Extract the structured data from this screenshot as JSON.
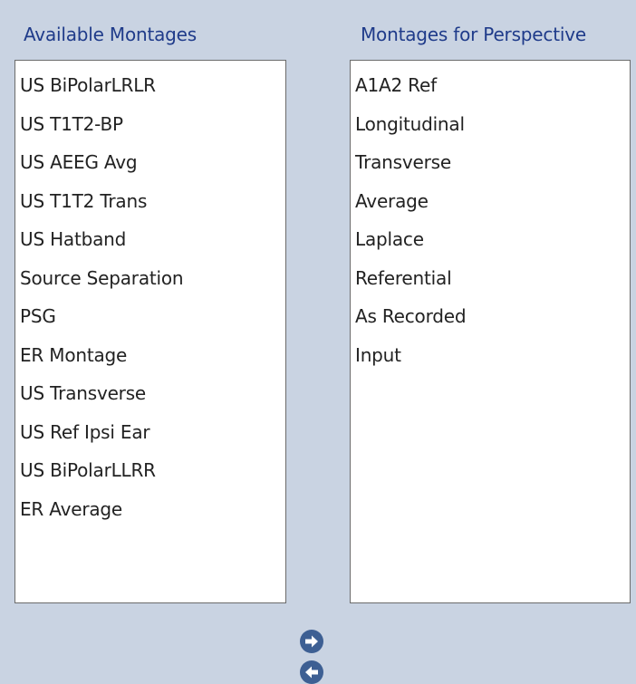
{
  "left_panel": {
    "title": "Available Montages",
    "items": [
      {
        "label": "US BiPolarLRLR"
      },
      {
        "label": "US T1T2-BP"
      },
      {
        "label": "US AEEG Avg"
      },
      {
        "label": "US T1T2 Trans"
      },
      {
        "label": "US Hatband"
      },
      {
        "label": "Source Separation"
      },
      {
        "label": "PSG"
      },
      {
        "label": "ER Montage"
      },
      {
        "label": "US Transverse"
      },
      {
        "label": "US Ref Ipsi Ear"
      },
      {
        "label": "US BiPolarLLRR"
      },
      {
        "label": "ER Average"
      }
    ]
  },
  "right_panel": {
    "title": "Montages for Perspective",
    "items": [
      {
        "label": "A1A2 Ref"
      },
      {
        "label": "Longitudinal"
      },
      {
        "label": "Transverse"
      },
      {
        "label": "Average"
      },
      {
        "label": "Laplace"
      },
      {
        "label": "Referential"
      },
      {
        "label": "As Recorded"
      },
      {
        "label": "Input"
      }
    ]
  },
  "transfer_buttons": {
    "add_icon": "arrow-right-circle-icon",
    "remove_icon": "arrow-left-circle-icon"
  },
  "colors": {
    "background": "#c9d3e2",
    "header_text": "#1f3b8a",
    "button": "#3d5f93"
  }
}
